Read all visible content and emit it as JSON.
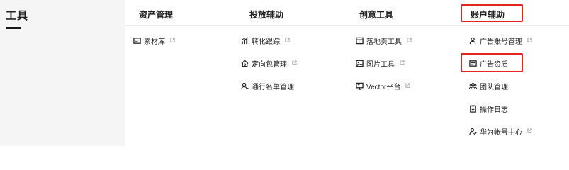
{
  "left": {
    "title": "工具"
  },
  "columns": [
    {
      "header": "资产管理",
      "items": [
        {
          "label": "素材库",
          "icon": "folder-icon",
          "external": true
        }
      ]
    },
    {
      "header": "投放辅助",
      "items": [
        {
          "label": "转化跟踪",
          "icon": "chart-icon",
          "external": true
        },
        {
          "label": "定向包管理",
          "icon": "home-icon",
          "external": true
        },
        {
          "label": "通行名单管理",
          "icon": "user-list-icon",
          "external": false
        }
      ]
    },
    {
      "header": "创意工具",
      "items": [
        {
          "label": "落地页工具",
          "icon": "page-icon",
          "external": true
        },
        {
          "label": "图片工具",
          "icon": "image-icon",
          "external": true
        },
        {
          "label": "Vector平台",
          "icon": "monitor-icon",
          "external": true
        }
      ]
    },
    {
      "header": "账户辅助",
      "items": [
        {
          "label": "广告账号管理",
          "icon": "user-icon",
          "external": true
        },
        {
          "label": "广告资质",
          "icon": "license-icon",
          "external": false
        },
        {
          "label": "团队管理",
          "icon": "team-icon",
          "external": false
        },
        {
          "label": "操作日志",
          "icon": "log-icon",
          "external": false
        },
        {
          "label": "华为帐号中心",
          "icon": "user-check-icon",
          "external": true
        }
      ]
    }
  ],
  "highlight_color": "#e5231f"
}
